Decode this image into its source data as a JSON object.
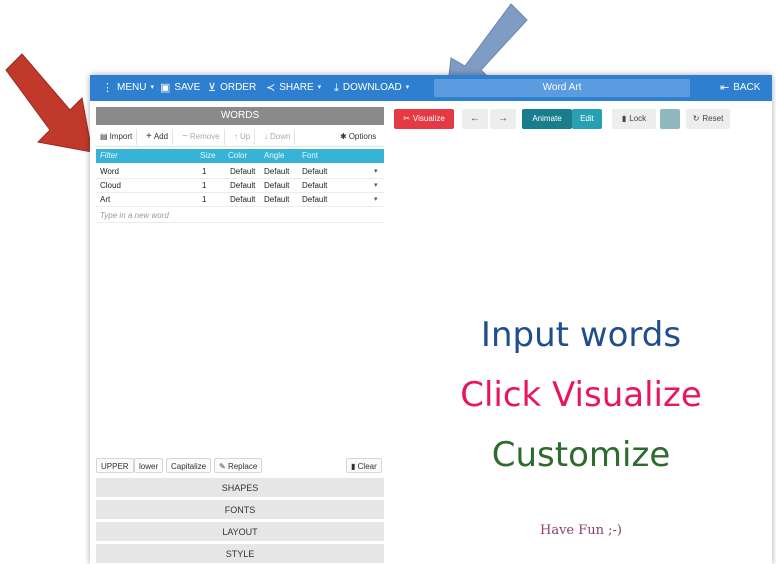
{
  "topbar": {
    "menu": "MENU",
    "save": "SAVE",
    "order": "ORDER",
    "share": "SHARE",
    "download": "DOWNLOAD",
    "title": "Word Art",
    "back": "BACK",
    "color": "#2f7fd0"
  },
  "words_panel": {
    "title": "WORDS",
    "toolbar": {
      "import": "Import",
      "add": "Add",
      "remove": "Remove",
      "up": "Up",
      "down": "Down",
      "options": "Options"
    },
    "columns": [
      "Filter",
      "Size",
      "Color",
      "Angle",
      "Font"
    ],
    "rows": [
      {
        "word": "Word",
        "size": "1",
        "color": "Default",
        "angle": "Default",
        "font": "Default"
      },
      {
        "word": "Cloud",
        "size": "1",
        "color": "Default",
        "angle": "Default",
        "font": "Default"
      },
      {
        "word": "Art",
        "size": "1",
        "color": "Default",
        "angle": "Default",
        "font": "Default"
      }
    ],
    "new_word_placeholder": "Type in a new word",
    "case_buttons": {
      "upper": "UPPER",
      "lower": "lower",
      "capitalize": "Capitalize",
      "replace": "Replace",
      "clear": "Clear"
    }
  },
  "accordion": [
    "SHAPES",
    "FONTS",
    "LAYOUT",
    "STYLE"
  ],
  "right_toolbar": {
    "visualize": "Visualize",
    "animate": "Animate",
    "edit": "Edit",
    "lock": "Lock",
    "reset": "Reset"
  },
  "canvas": {
    "line1": "Input words",
    "line2": "Click Visualize",
    "line3": "Customize",
    "line4": "Have Fun ;-)",
    "colors": {
      "line1": "#1f4e8c",
      "line2": "#e8175d",
      "line3": "#2d6a2d",
      "line4": "#8a3c6e"
    }
  },
  "arrows": {
    "red": "#c0392b",
    "blue": "#7f9cc4"
  }
}
